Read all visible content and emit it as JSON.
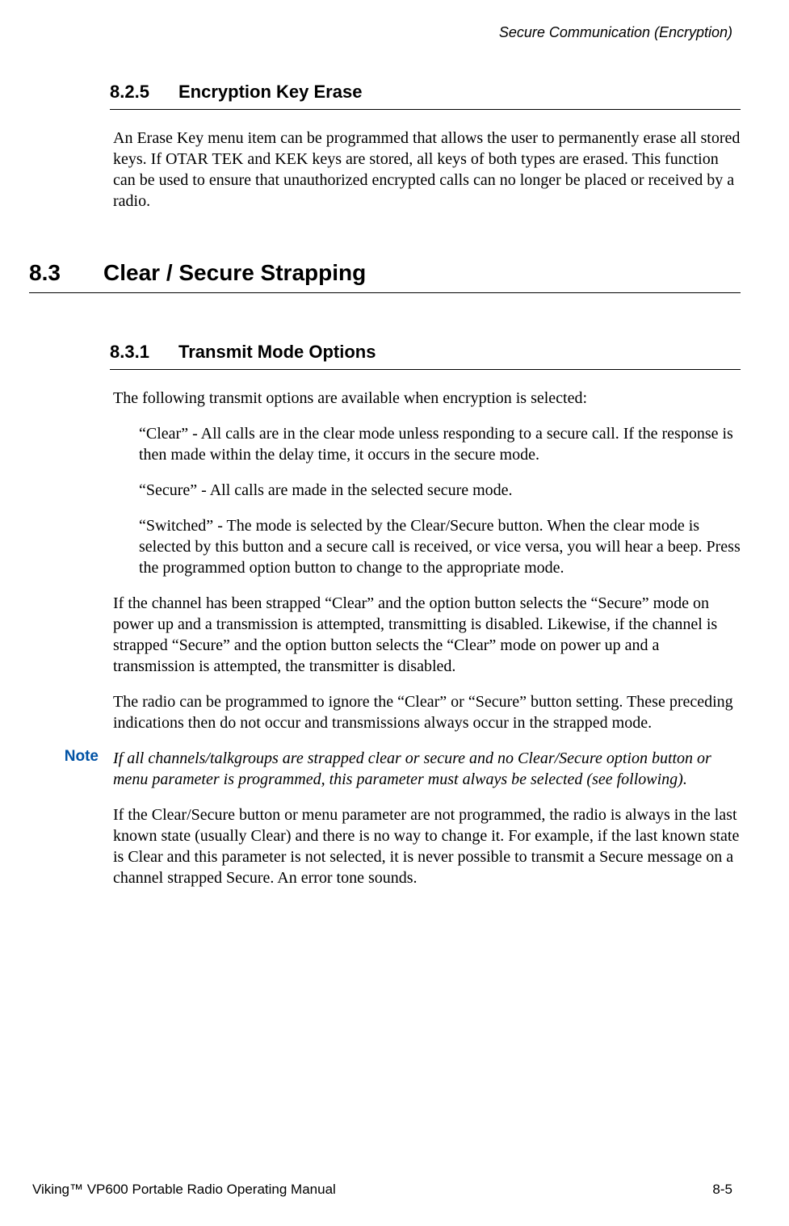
{
  "header": {
    "chapter_title": "Secure Communication (Encryption)"
  },
  "section_825": {
    "number": "8.2.5",
    "title": "Encryption Key Erase",
    "para1": "An Erase Key menu item can be programmed that allows the user to permanently erase all stored keys. If OTAR TEK and KEK keys are stored, all keys of both types are erased. This function can be used to ensure that unauthorized encrypted calls can no longer be placed or received by a radio."
  },
  "section_83": {
    "number": "8.3",
    "title": "Clear / Secure Strapping"
  },
  "section_831": {
    "number": "8.3.1",
    "title": "Transmit Mode Options",
    "para1": "The following transmit options are available when encryption is selected:",
    "opt1": "“Clear” - All calls are in the clear mode unless responding to a secure call. If the response is then made within the delay time, it occurs in the secure mode.",
    "opt2": "“Secure” - All calls are made in the selected secure mode.",
    "opt3": "“Switched” - The mode is selected by the Clear/Secure button. When the clear mode is selected by this button and a secure call is received, or vice versa, you will hear a beep. Press the programmed option button to change to the appropriate mode.",
    "para2": "If the channel has been strapped “Clear” and the option button selects the “Secure” mode on power up and a transmission is attempted, transmitting is disabled. Likewise, if the channel is strapped “Secure” and the option button selects the “Clear” mode on power up and a transmission is attempted, the transmitter is disabled.",
    "para3": "The radio can be programmed to ignore the “Clear” or “Secure” button setting. These preceding indications then do not occur and transmissions always occur in the strapped mode.",
    "note_label": "Note",
    "note_text": "If all channels/talkgroups are strapped clear or secure and no Clear/Secure option button or menu parameter is programmed, this parameter must always be selected (see following).",
    "para4": "If the Clear/Secure button or menu parameter are not programmed, the radio is always in the last known state (usually Clear) and there is no way to change it. For example, if the last known state is Clear and this parameter is not selected, it is never possible to transmit a Secure message on a channel strapped Secure. An error tone sounds."
  },
  "footer": {
    "manual": "Viking™ VP600 Portable Radio Operating Manual",
    "page": "8-5"
  }
}
